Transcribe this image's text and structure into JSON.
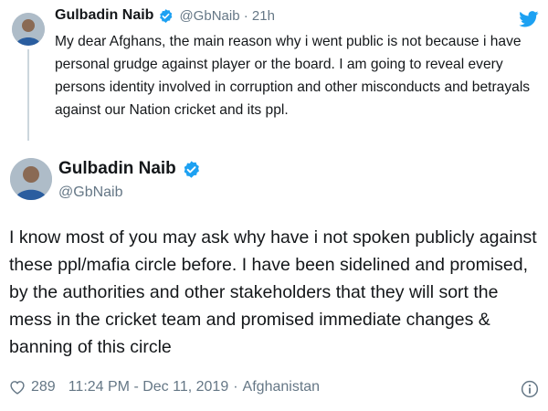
{
  "parent": {
    "author_name": "Gulbadin Naib",
    "handle": "@GbNaib",
    "separator": "·",
    "time": "21h",
    "text": "My dear Afghans, the main reason why i went public is not because i have personal grudge against player or the board. I am going to reveal every persons identity involved in corruption and other misconducts and betrayals against our Nation cricket and its ppl."
  },
  "main": {
    "author_name": "Gulbadin Naib",
    "handle": "@GbNaib",
    "text": "I know most of you may ask why have i not spoken publicly against these ppl/mafia circle before. I have been sidelined and promised, by the authorities and other stakeholders that they will sort the mess in the cricket team and promised immediate changes & banning of this circle",
    "likes": "289",
    "timestamp": "11:24 PM - Dec 11, 2019",
    "location_sep": "·",
    "location": "Afghanistan"
  },
  "icons": {
    "verified": "verified-badge-icon",
    "twitter": "twitter-bird-icon",
    "like": "heart-icon",
    "info": "info-icon"
  },
  "colors": {
    "brand_blue": "#1da1f2",
    "text": "#14171a",
    "muted": "#657786",
    "thread_line": "#ccd6dd"
  }
}
